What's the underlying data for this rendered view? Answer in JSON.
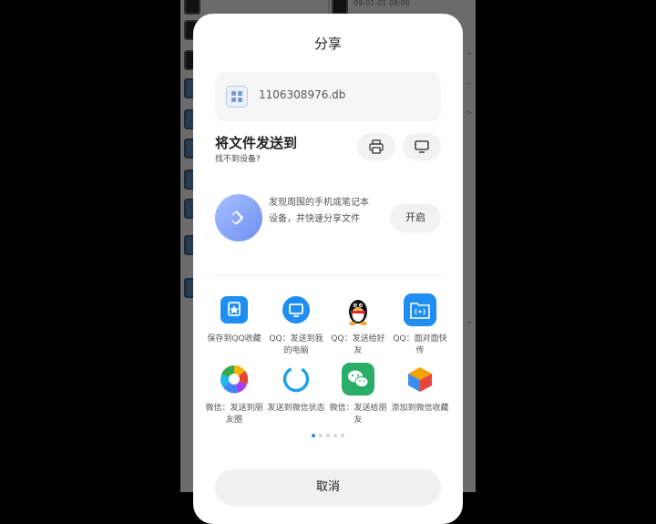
{
  "background": {
    "date_text": "09-01-01 08:00",
    "arrows": [
      "->",
      "->",
      "->",
      "->"
    ]
  },
  "sheet": {
    "title": "分享",
    "file": {
      "name": "1106308976.db"
    },
    "send": {
      "title": "将文件发送到",
      "subtitle": "找不到设备?"
    },
    "device_buttons": [
      {
        "icon": "printer-icon"
      },
      {
        "icon": "monitor-icon"
      }
    ],
    "discover": {
      "text": "发现周围的手机或笔记本设备，并快速分享文件",
      "open_label": "开启"
    },
    "apps": [
      {
        "label": "保存到QQ收藏",
        "icon": "qq-favorites-icon"
      },
      {
        "label": "QQ：发送到我的电脑",
        "icon": "qq-my-computer-icon"
      },
      {
        "label": "QQ：发送给好友",
        "icon": "qq-penguin-icon"
      },
      {
        "label": "QQ：面对面快传",
        "icon": "qq-face-to-face-icon"
      },
      {
        "label": "微信：发送到朋友圈",
        "icon": "wechat-moments-icon"
      },
      {
        "label": "发送到微信状态",
        "icon": "wechat-status-icon"
      },
      {
        "label": "微信：发送给朋友",
        "icon": "wechat-icon"
      },
      {
        "label": "添加到微信收藏",
        "icon": "wechat-favorites-icon"
      }
    ],
    "pager": {
      "pages": 5,
      "active": 1
    },
    "cancel_label": "取消"
  },
  "colors": {
    "accent": "#2f80ed",
    "qq_blue": "#1e8ef0",
    "wechat_green": "#2aae67"
  }
}
